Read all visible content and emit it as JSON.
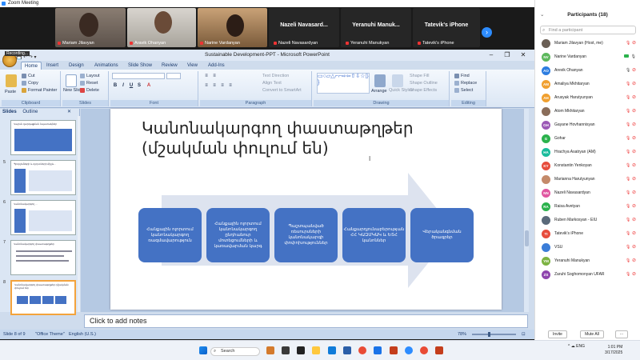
{
  "zoom": {
    "window_title": "Zoom Meeting",
    "video_tiles": [
      {
        "name": "Mariam Jilavyan",
        "kind": "camera"
      },
      {
        "name": "Aravik Ohanyan",
        "kind": "camera"
      },
      {
        "name": "Narine Vardanyan",
        "kind": "camera"
      },
      {
        "name": "Nazeli Navasard...",
        "label": "Nazeli Navasardyan",
        "kind": "text"
      },
      {
        "name": "Yeranuhi Manuk...",
        "label": "Yeranuhi Manukyan",
        "kind": "text"
      },
      {
        "name": "Tatevik's iPhone",
        "label": "Tatevik's iPhone",
        "kind": "text"
      }
    ],
    "recording_label": "Recording..."
  },
  "ppt": {
    "window_title": "Sustainable Development-PPT - Microsoft PowerPoint",
    "tabs": [
      "Home",
      "Insert",
      "Design",
      "Animations",
      "Slide Show",
      "Review",
      "View",
      "Add-Ins"
    ],
    "ribbon": {
      "clipboard": {
        "label": "Clipboard",
        "paste": "Paste",
        "cut": "Cut",
        "copy": "Copy",
        "format_painter": "Format Painter"
      },
      "slides": {
        "label": "Slides",
        "new_slide": "New Slide",
        "layout": "Layout",
        "reset": "Reset",
        "delete": "Delete"
      },
      "font": {
        "label": "Font"
      },
      "paragraph": {
        "label": "Paragraph",
        "text_direction": "Text Direction",
        "align_text": "Align Text",
        "smartart": "Convert to SmartArt"
      },
      "drawing": {
        "label": "Drawing",
        "arrange": "Arrange",
        "quick_styles": "Quick Styles",
        "shape_fill": "Shape Fill",
        "shape_outline": "Shape Outline",
        "shape_effects": "Shape Effects"
      },
      "editing": {
        "label": "Editing",
        "find": "Find",
        "replace": "Replace",
        "select": "Select"
      }
    },
    "panel_tabs": [
      "Slides",
      "Outline"
    ],
    "thumbnails": [
      {
        "num": "",
        "title": "Կայուն զարգացման նպատակներ"
      },
      {
        "num": "5",
        "title": "Պրոբլեմների և ոլորտների միջև..."
      },
      {
        "num": "6",
        "title": "Կանոնակարգող ..."
      },
      {
        "num": "7",
        "title": "Կանոնակարգող փաստաթղթեր"
      },
      {
        "num": "8",
        "title": "Կանոնակարգող փաստաթղթեր (մշակման փուլում են)"
      }
    ],
    "slide": {
      "title_line1": "Կանոնակարգող փաստաթղթեր",
      "title_line2": "(մշակման փուլում են)",
      "boxes": [
        "Հանքային ոլորտում կանոնակարգող ռազմավարություն",
        "Հանքային ոլորտում կանոնակարգող ընդհանուր մոտեցումների և կառավարման կարգ",
        "Պաշտպանված ռեսուրսների կանոնակարգի փոփոխություններ",
        "Հանքարդյունաբերության ՀՀ ԿԱԶՄԿԱԿ և ԵՏՀ կանոններ",
        "Վերականգնման ծրագրեր"
      ]
    },
    "notes_placeholder": "Click to add notes",
    "status": {
      "slide": "Slide 8 of 9",
      "theme": "\"Office Theme\"",
      "language": "English (U.S.)",
      "zoom": "78%"
    }
  },
  "participants": {
    "title": "Participants (18)",
    "search_placeholder": "Find a participant",
    "list": [
      {
        "initials": "",
        "name": "Mariam Jilavyan (Host, me)",
        "color": "#6b5f55",
        "muted": true,
        "video": false
      },
      {
        "initials": "NV",
        "name": "Narine Vardanyan",
        "color": "#5db85c",
        "muted": false,
        "video": true
      },
      {
        "initials": "AO",
        "name": "Arevik Ohanyan",
        "color": "#2d7de0",
        "muted": false,
        "video": false
      },
      {
        "initials": "AM",
        "name": "Amaliya Mkhitaryan",
        "color": "#f0a030",
        "muted": true,
        "video": false
      },
      {
        "initials": "AH",
        "name": "Arusyak Harutyunyan",
        "color": "#f0a030",
        "muted": true,
        "video": false
      },
      {
        "initials": "",
        "name": "Atom Mkhitaryan",
        "color": "#8a6d5a",
        "muted": true,
        "video": false
      },
      {
        "initials": "GH",
        "name": "Gayane Hovhannisyan",
        "color": "#9b59b6",
        "muted": true,
        "video": false
      },
      {
        "initials": "G",
        "name": "Gohar",
        "color": "#2bb24c",
        "muted": true,
        "video": false
      },
      {
        "initials": "HA",
        "name": "Hrachya Asatryan (AM)",
        "color": "#1abc9c",
        "muted": true,
        "video": false
      },
      {
        "initials": "KY",
        "name": "Konstantin Yenkoyan",
        "color": "#e74c3c",
        "muted": true,
        "video": false
      },
      {
        "initials": "",
        "name": "Marianna Harutyunyan",
        "color": "#c48a6a",
        "muted": true,
        "video": false
      },
      {
        "initials": "NN",
        "name": "Nazeli Navasardyan",
        "color": "#e056a0",
        "muted": true,
        "video": false
      },
      {
        "initials": "RA",
        "name": "Raisa Avetyan",
        "color": "#2bb24c",
        "muted": true,
        "video": false
      },
      {
        "initials": "",
        "name": "Ruben Markosyan - EIU",
        "color": "#5a6a7a",
        "muted": true,
        "video": false
      },
      {
        "initials": "TI",
        "name": "Tatevik's iPhone",
        "color": "#e74c3c",
        "muted": true,
        "video": false
      },
      {
        "initials": "",
        "name": "VSU",
        "color": "#3b7dd8",
        "muted": true,
        "video": false
      },
      {
        "initials": "YM",
        "name": "Yeranuhi Manukyan",
        "color": "#7cb342",
        "muted": true,
        "video": false
      },
      {
        "initials": "ZS",
        "name": "Zaruhi Soghomonyan UFAR",
        "color": "#8e44ad",
        "muted": true,
        "video": false
      }
    ],
    "invite": "Invite",
    "mute_all": "Mute All"
  },
  "taskbar": {
    "search": "Search",
    "lang": "ENG",
    "time": "1:01 PM",
    "date": "3/17/2025"
  }
}
